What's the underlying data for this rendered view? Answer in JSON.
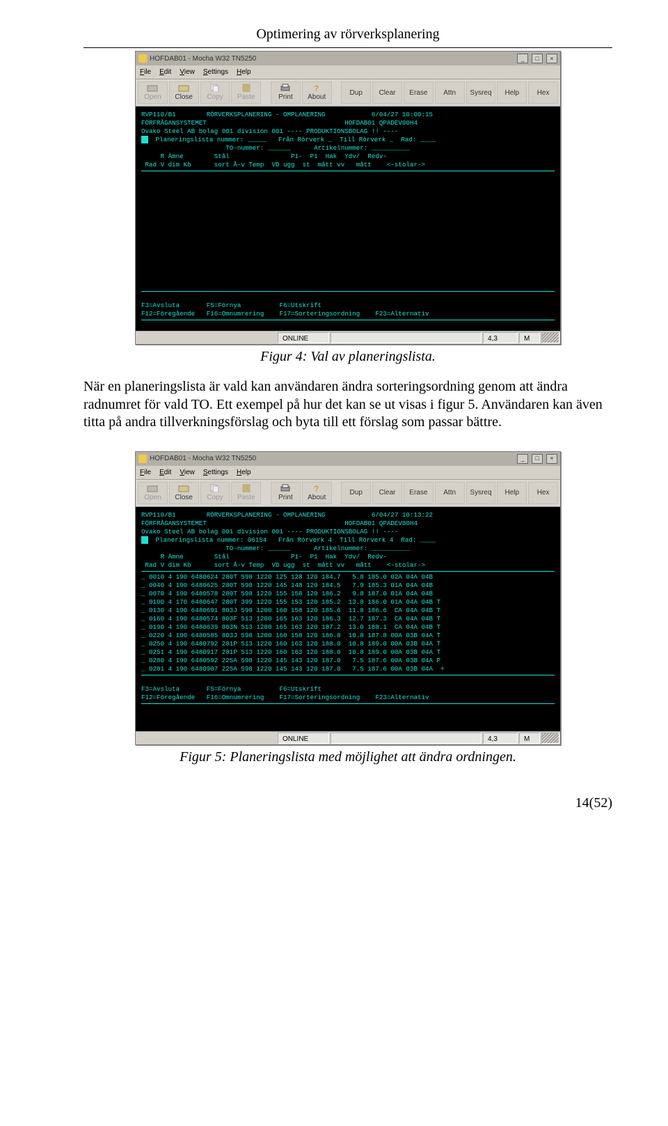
{
  "doc": {
    "header": "Optimering av rörverksplanering",
    "fig1_caption": "Figur 4: Val av planeringslista.",
    "paragraph": "När en planeringslista är vald kan användaren ändra sorteringsordning genom att ändra radnumret för vald TO. Ett exempel på hur det kan se ut visas i figur 5. Användaren kan även titta på andra tillverkningsförslag och byta till ett förslag som passar bättre.",
    "fig2_caption": "Figur 5: Planeringslista med möjlighet att ändra ordningen.",
    "pagenum": "14(52)"
  },
  "win": {
    "title": "HOFDAB01 - Mocha W32 TN5250",
    "menu": {
      "file": "File",
      "edit": "Edit",
      "view": "View",
      "settings": "Settings",
      "help": "Help"
    },
    "toolbar": {
      "open": "Open",
      "close": "Close",
      "copy": "Copy",
      "paste": "Paste",
      "print": "Print",
      "about": "About",
      "dup": "Dup",
      "clear": "Clear",
      "erase": "Erase",
      "attn": "Attn",
      "sysreq": "Sysreq",
      "help": "Help",
      "hex": "Hex"
    },
    "status1": {
      "online": "ONLINE",
      "pos": "4,3",
      "mode": "M"
    },
    "status2": {
      "online": "ONLINE",
      "pos": "4,3",
      "mode": "M"
    },
    "screen1": {
      "l1a": "RVP110/B1        RÖRVERKSPLANERING - OMPLANERING            6/04/27 10:00:15",
      "l2": "FÖRFRÅGANSYSTEMET                                    HOFDAB01 QPADEV00H4",
      "l3": "Ovako Steel AB bolag 001 division 001 ---- PRODUKTIONSBOLAG !! ----",
      "l4": "  Planeringslista nummer: _____   Från Rörverk _  Till Rörverk _  Rad: ____",
      "l5": "                      TO-nummer: ______      Artikelnummer: __________",
      "l6": "     R Ämne        Stål                P1-  P1  Hak  Ydv/  Redv-",
      "l7": " Rad V dim Kb      sort Å-v Temp  VD ugg  st  mått vv   mått    <-stolar->",
      "f1": "F3=Avsluta       F5=Förnya          F6=Utskrift",
      "f2": "F12=Föregående   F16=Omnumrering    F17=Sorteringsordning    F23=Alternativ"
    },
    "screen2": {
      "l1": "RVP110/B1        RÖRVERKSPLANERING - OMPLANERING            6/04/27 10:13:22",
      "l2": "FÖRFRÅGANSYSTEMET                                    HOFDAB01 QPADEV00H4",
      "l3": "Ovako Steel AB bolag 001 division 001 ---- PRODUKTIONSBOLAG !! ----",
      "l4": "  Planeringslista nummer: 06154   Från Rörverk 4  Till Rörverk 4  Rad: ____",
      "l5": "                      TO-nummer: ______      Artikelnummer: __________",
      "l6": "     R Ämne        Stål                P1-  P1  Hak  Ydv/  Redv-",
      "l7": " Rad V dim Kb      sort Å-v Temp  VD ugg  st  mått vv   mått    <-stolar->",
      "r01": "_ 0010 4 190 6480624 280T 598 1220 125 128 120 184.7   5.8 185.0 02A 04A 04B",
      "r02": "_ 0040 4 190 6480625 280T 598 1220 145 148 120 184.5   7.9 185.3 01A 04A 04B",
      "r03": "_ 0070 4 190 6480578 280T 598 1220 155 158 120 186.2   9.8 187.0 01A 04A 04B",
      "r04": "_ 0100 4 170 6480647 280T 399 1220 155 153 120 185.2  13.8 186.0 01A 04A 04B T",
      "r05": "_ 0130 4 190 6480691 803J 598 1200 160 158 120 185.6  11.8 186.6  CA 04A 04B T",
      "r06": "_ 0160 4 190 6480574 803F 513 1200 165 163 120 186.3  12.7 187.3  CA 04A 04B T",
      "r07": "_ 0190 4 190 6480639 803N 513 1200 165 163 120 187.2  13.0 188.1  CA 04A 04B T",
      "r08": "_ 0220 4 190 6480585 803J 598 1200 160 158 120 186.8  10.8 187.8 00A 03B 04A T",
      "r09": "_ 0250 4 190 6480792 281P 513 1220 160 163 120 188.0  10.8 189.0 00A 03B 04A T",
      "r10": "_ 0251 4 190 6480917 281P 513 1220 160 163 120 188.0  10.8 189.0 00A 03B 04A T",
      "r11": "_ 0280 4 190 6480592 225A 598 1220 145 143 120 187.0   7.5 187.6 00A 03B 04A P",
      "r12": "_ 0281 4 190 6480907 225A 598 1220 145 143 120 187.0   7.5 187.6 00A 03B 04A  +",
      "f1": "F3=Avsluta       F5=Förnya          F6=Utskrift",
      "f2": "F12=Föregående   F16=Omnumrering    F17=Sorteringsordning    F23=Alternativ"
    }
  }
}
